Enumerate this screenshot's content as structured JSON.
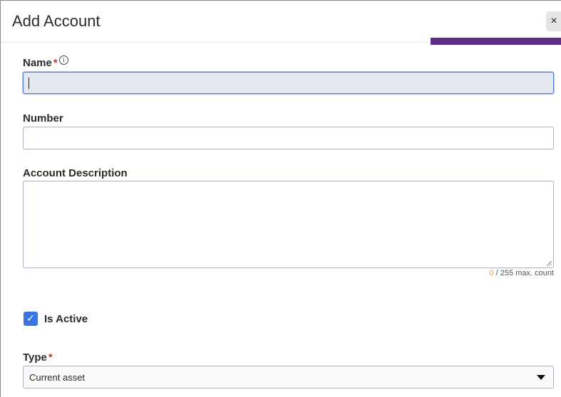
{
  "dialog": {
    "title": "Add Account",
    "close_glyph": "×"
  },
  "fields": {
    "name": {
      "label": "Name",
      "required_mark": "*",
      "info_glyph": "i",
      "value": ""
    },
    "number": {
      "label": "Number",
      "value": ""
    },
    "description": {
      "label": "Account Description",
      "value": "",
      "count": "0",
      "count_suffix": " / 255 max. count"
    },
    "is_active": {
      "label": "Is Active",
      "checked": true,
      "check_glyph": "✓"
    },
    "type": {
      "label": "Type",
      "required_mark": "*",
      "selected": "Current asset"
    }
  },
  "colors": {
    "accent": "#5b2d86",
    "checkbox": "#3b74e0",
    "required": "#d0342c",
    "counter_value": "#e0a22e"
  }
}
